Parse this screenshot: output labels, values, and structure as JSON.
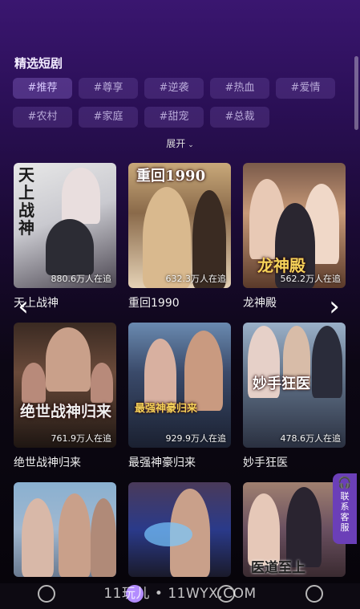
{
  "section": {
    "title": "精选短剧"
  },
  "tags": [
    "#推荐",
    "#尊享",
    "#逆袭",
    "#热血",
    "#爱情",
    "#农村",
    "#家庭",
    "#甜宠",
    "#总裁"
  ],
  "expand": {
    "label": "展开"
  },
  "cards": [
    {
      "name": "天上战神",
      "viewers": "880.6万人在追",
      "poster_text": "天上战神"
    },
    {
      "name": "重回1990",
      "viewers": "632.3万人在追",
      "poster_text": "重回1990"
    },
    {
      "name": "龙神殿",
      "viewers": "562.2万人在追",
      "poster_text": "龙神殿"
    },
    {
      "name": "绝世战神归来",
      "viewers": "761.9万人在追",
      "poster_text": "绝世战神归来"
    },
    {
      "name": "最强神豪归来",
      "viewers": "929.9万人在追",
      "poster_text": "最强神豪归来"
    },
    {
      "name": "妙手狂医",
      "viewers": "478.6万人在追",
      "poster_text": "妙手狂医"
    },
    {
      "name": "",
      "viewers": "",
      "poster_text": ""
    },
    {
      "name": "",
      "viewers": "",
      "poster_text": ""
    },
    {
      "name": "",
      "viewers": "",
      "poster_text": "医道至上"
    }
  ],
  "nav": {
    "prev": "‹",
    "next": "›"
  },
  "service": {
    "label": "联系客服"
  },
  "watermark": "11玩儿 • 11WYX.COM",
  "colors": {
    "accent": "#b38cff",
    "tag_bg": "#3b2a5c",
    "title_gold": "#f6d35a"
  }
}
